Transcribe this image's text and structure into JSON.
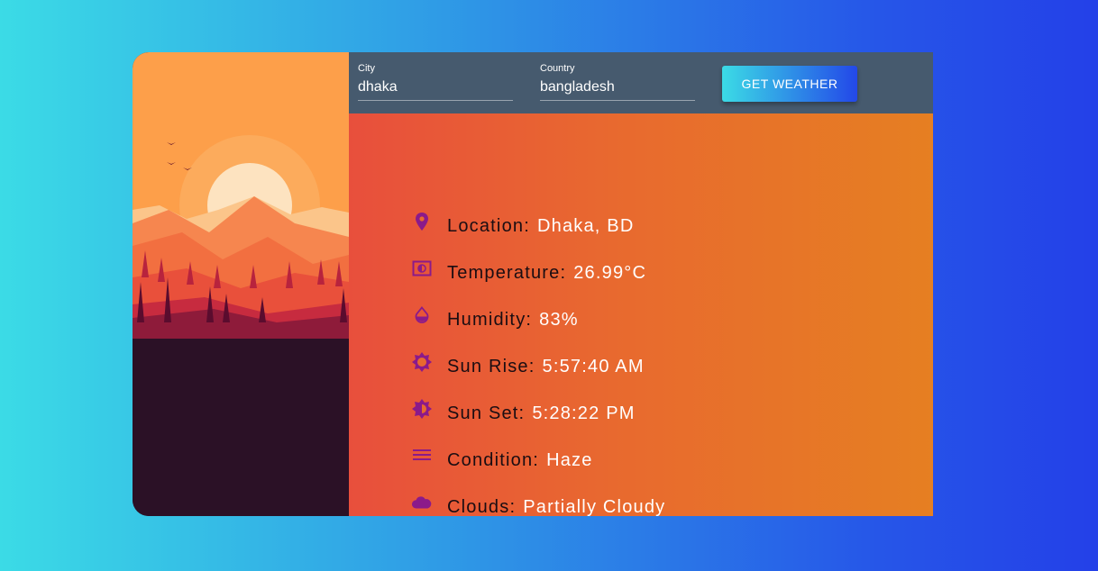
{
  "colors": {
    "accent": "#8b1a8a",
    "panel": "#465a6e"
  },
  "form": {
    "city_label": "City",
    "city_value": "dhaka",
    "country_label": "Country",
    "country_value": "bangladesh",
    "button_label": "GET WEATHER"
  },
  "info": {
    "location": {
      "key": "Location:",
      "value": "Dhaka, BD",
      "icon": "map-pin-icon"
    },
    "temperature": {
      "key": "Temperature:",
      "value": "26.99°C",
      "icon": "thermometer-card-icon"
    },
    "humidity": {
      "key": "Humidity:",
      "value": "83%",
      "icon": "water-drop-icon"
    },
    "sunrise": {
      "key": "Sun Rise:",
      "value": "5:57:40 AM",
      "icon": "sun-icon"
    },
    "sunset": {
      "key": "Sun Set:",
      "value": "5:28:22 PM",
      "icon": "sun-half-icon"
    },
    "condition": {
      "key": "Condition:",
      "value": "Haze",
      "icon": "lines-icon"
    },
    "clouds": {
      "key": "Clouds:",
      "value": "Partially Cloudy",
      "icon": "cloud-icon"
    }
  }
}
